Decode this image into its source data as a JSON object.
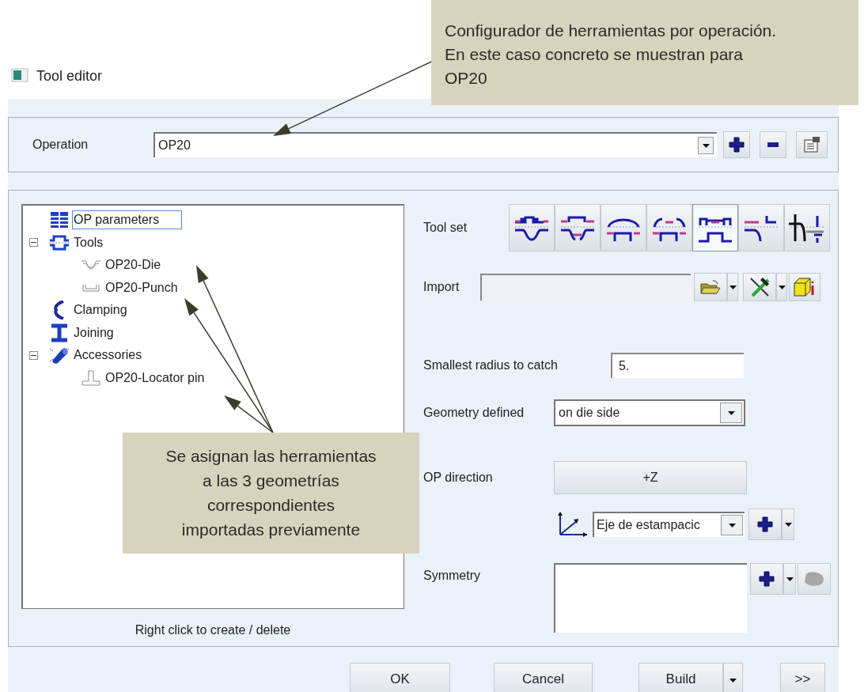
{
  "window": {
    "title": "Tool editor"
  },
  "operation": {
    "label": "Operation",
    "value": "OP20"
  },
  "tree": {
    "items": [
      {
        "kind": "parameters",
        "label": "OP parameters",
        "selected": true
      },
      {
        "kind": "tools",
        "label": "Tools",
        "selected": false,
        "expanded": true,
        "children": [
          {
            "kind": "die",
            "label": "OP20-Die",
            "selected": false
          },
          {
            "kind": "punch",
            "label": "OP20-Punch",
            "selected": false
          }
        ]
      },
      {
        "kind": "clamping",
        "label": "Clamping",
        "selected": false
      },
      {
        "kind": "joining",
        "label": "Joining",
        "selected": false
      },
      {
        "kind": "accessories",
        "label": "Accessories",
        "selected": false,
        "expanded": true,
        "children": [
          {
            "kind": "pin",
            "label": "OP20-Locator pin",
            "selected": false
          }
        ]
      }
    ],
    "hint": "Right click to create / delete"
  },
  "tool_set": {
    "label": "Tool set",
    "buttons": [
      {
        "kind": "die_punch",
        "selected": false
      },
      {
        "kind": "die_punch_binder",
        "selected": false
      },
      {
        "kind": "punch_die",
        "selected": false
      },
      {
        "kind": "punch_die_binder",
        "selected": false
      },
      {
        "kind": "double_draw",
        "selected": true
      },
      {
        "kind": "flange",
        "selected": false
      },
      {
        "kind": "direction",
        "selected": false
      }
    ]
  },
  "import": {
    "label": "Import"
  },
  "radius": {
    "label": "Smallest radius to catch",
    "value": "5."
  },
  "geometry": {
    "label": "Geometry defined",
    "value": "on die side"
  },
  "op_direction": {
    "label": "OP direction",
    "button": "+Z",
    "axis": "Eje de estampacic"
  },
  "symmetry": {
    "label": "Symmetry"
  },
  "buttons": [
    {
      "label": "OK",
      "kind": "plain"
    },
    {
      "label": "Cancel",
      "kind": "plain"
    },
    {
      "label": "Build",
      "kind": "split"
    },
    {
      "label": ">>",
      "kind": "plain"
    }
  ],
  "annotations": [
    {
      "lines": [
        "Configurador de herramientas por operación.",
        "En este caso concreto se muestran para",
        "OP20"
      ]
    },
    {
      "lines": [
        "Se asignan las herramientas",
        "a las 3 geometrías",
        "correspondientes",
        "importadas previamente"
      ]
    }
  ]
}
